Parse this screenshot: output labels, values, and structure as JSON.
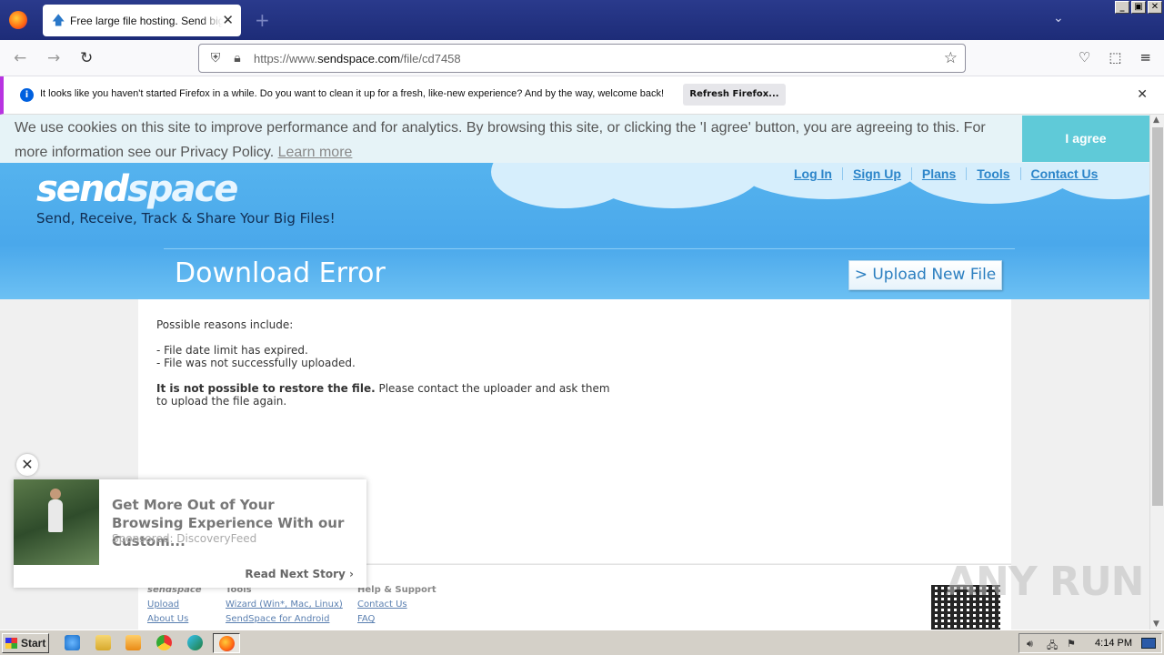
{
  "browser": {
    "tab_title": "Free large file hosting. Send big files",
    "url_prefix": "https://www.",
    "url_domain": "sendspace.com",
    "url_path": "/file/cd7458"
  },
  "notification": {
    "text": "It looks like you haven't started Firefox in a while. Do you want to clean it up for a fresh, like-new experience? And by the way, welcome back!",
    "button": "Refresh Firefox..."
  },
  "cookie": {
    "text": "We use cookies on this site to improve performance and for analytics. By browsing this site, or clicking the 'I agree' button, you are agreeing to this. For more information see our Privacy Policy.",
    "learn_more": "Learn more",
    "agree": "I agree"
  },
  "header": {
    "logo_send": "send",
    "logo_space": "space",
    "tagline": "Send, Receive, Track & Share Your Big Files!",
    "nav": [
      "Log In",
      "Sign Up",
      "Plans",
      "Tools",
      "Contact Us"
    ],
    "title": "Download Error",
    "upload_button": "> Upload New File"
  },
  "content": {
    "intro": "Possible reasons include:",
    "reason1": "- File date limit has expired.",
    "reason2": "- File was not successfully uploaded.",
    "bold": "It is not possible to restore the file.",
    "rest1": " Please contact the uploader and ask them",
    "rest2": "to upload the file again."
  },
  "footer": {
    "col1_head": "sendspace",
    "col1_links": [
      "Upload",
      "About Us"
    ],
    "col2_head": "Tools",
    "col2_links": [
      "Wizard (Win*, Mac, Linux)",
      "SendSpace for Android"
    ],
    "col3_head": "Help & Support",
    "col3_links": [
      "Contact Us",
      "FAQ"
    ]
  },
  "ad": {
    "title": "Get More Out of Your Browsing Experience With our Custom...",
    "sponsor": "Sponsored: DiscoveryFeed",
    "next": "Read Next Story"
  },
  "watermark": "ANY RUN",
  "taskbar": {
    "start": "Start",
    "clock": "4:14 PM"
  },
  "colors": {
    "header_blue": "#4aa8eb",
    "agree_teal": "#5fcad8",
    "link_blue": "#2c85c9"
  }
}
